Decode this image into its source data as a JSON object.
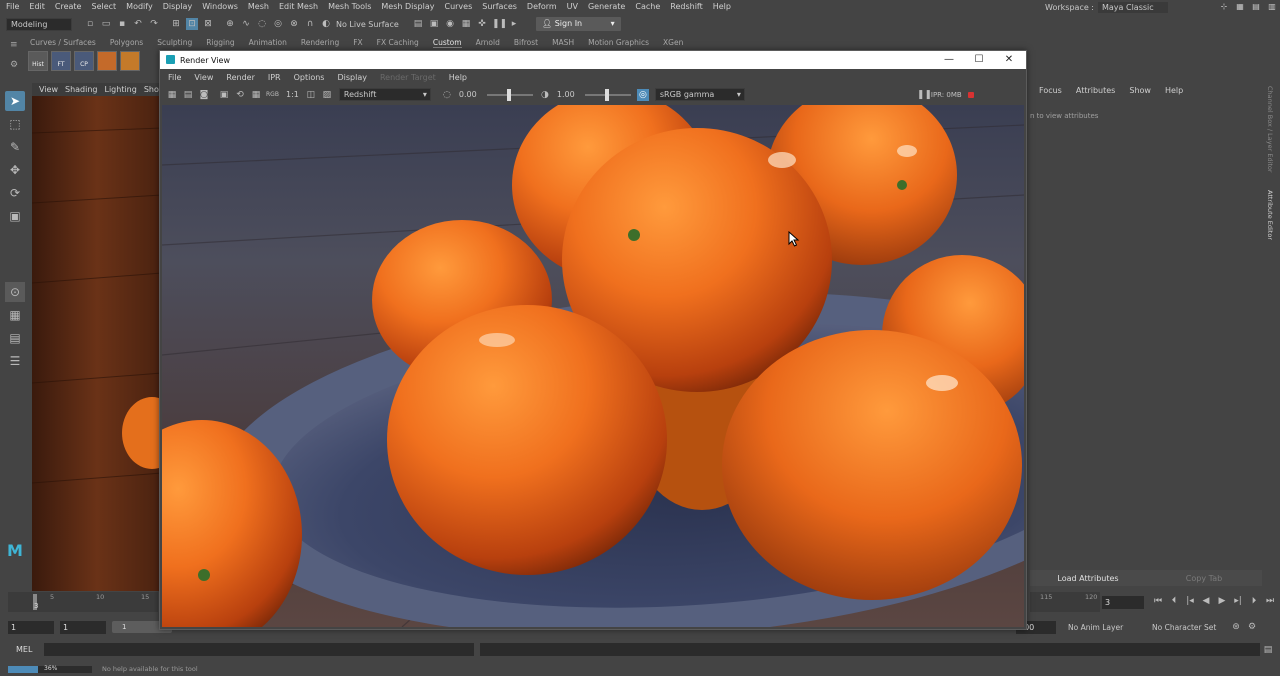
{
  "menubar": [
    "File",
    "Edit",
    "Create",
    "Select",
    "Modify",
    "Display",
    "Windows",
    "Mesh",
    "Edit Mesh",
    "Mesh Tools",
    "Mesh Display",
    "Curves",
    "Surfaces",
    "Deform",
    "UV",
    "Generate",
    "Cache",
    "Redshift",
    "Help"
  ],
  "workspace": {
    "label": "Workspace :",
    "value": "Maya Classic"
  },
  "statusline": {
    "mode": "Modeling",
    "live_surface": "No Live Surface",
    "sign_in": "Sign In"
  },
  "shelf_tabs": [
    "Curves / Surfaces",
    "Polygons",
    "Sculpting",
    "Rigging",
    "Animation",
    "Rendering",
    "FX",
    "FX Caching",
    "Custom",
    "Arnold",
    "Bifrost",
    "MASH",
    "Motion Graphics",
    "XGen"
  ],
  "shelf_active": "Custom",
  "shelf_icons": [
    "Hist",
    "FT",
    "CP"
  ],
  "viewport_menu": [
    "View",
    "Shading",
    "Lighting",
    "Show"
  ],
  "attr_editor": {
    "menu": [
      "Focus",
      "Attributes",
      "Show",
      "Help"
    ],
    "hint": "Select an object to view attributes",
    "hint_visible": "n to view attributes",
    "load_attributes": "Load Attributes",
    "copy_tab": "Copy Tab",
    "side_tabs": [
      "Channel Box / Layer Editor",
      "Attribute Editor"
    ]
  },
  "render_view": {
    "title": "Render View",
    "menu": [
      "File",
      "View",
      "Render",
      "IPR",
      "Options",
      "Display",
      "Render Target",
      "Help"
    ],
    "renderer": "Redshift",
    "ratio": "1:1",
    "exposure": "0.00",
    "gamma": "1.00",
    "color_space": "sRGB gamma",
    "ipr_memory": "IPR: 0MB"
  },
  "timeline": {
    "current_frame": "3",
    "tick_labels": [
      "3",
      "5",
      "10",
      "15"
    ],
    "end_ticks": [
      "115",
      "120"
    ]
  },
  "range": {
    "start": "1",
    "start_inner": "1",
    "end_inner": "1",
    "end": "200",
    "anim_layer": "No Anim Layer",
    "character_set": "No Character Set"
  },
  "commandline": {
    "lang": "MEL"
  },
  "helpline": {
    "progress_label": "36%",
    "progress": 0.36,
    "message": "No help available for this tool"
  }
}
